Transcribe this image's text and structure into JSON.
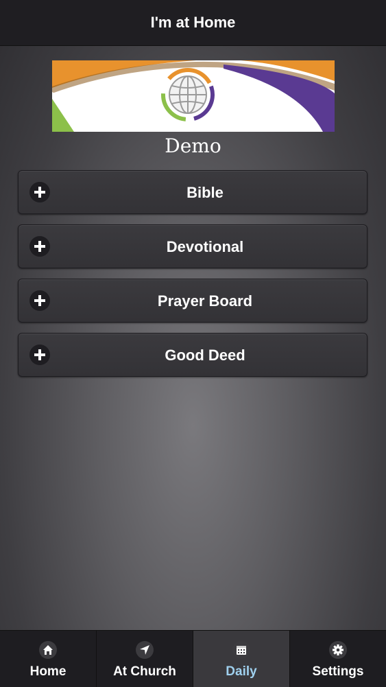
{
  "header": {
    "title": "I'm at Home"
  },
  "logo_caption": "Demo",
  "menu": [
    {
      "label": "Bible",
      "icon": "plus-icon"
    },
    {
      "label": "Devotional",
      "icon": "plus-icon"
    },
    {
      "label": "Prayer Board",
      "icon": "plus-icon"
    },
    {
      "label": "Good Deed",
      "icon": "plus-icon"
    }
  ],
  "tabs": [
    {
      "label": "Home",
      "icon": "home-icon"
    },
    {
      "label": "At Church",
      "icon": "navigation-arrow-icon"
    },
    {
      "label": "Daily",
      "icon": "calendar-icon",
      "active": true
    },
    {
      "label": "Settings",
      "icon": "gear-icon"
    }
  ],
  "colors": {
    "header_bg": "#1f1e22",
    "button_bg": "#38373b",
    "active_tab_label": "#9fd0ee",
    "logo_orange": "#e8922d",
    "logo_purple": "#5a3a92",
    "logo_green": "#8cc04a"
  }
}
